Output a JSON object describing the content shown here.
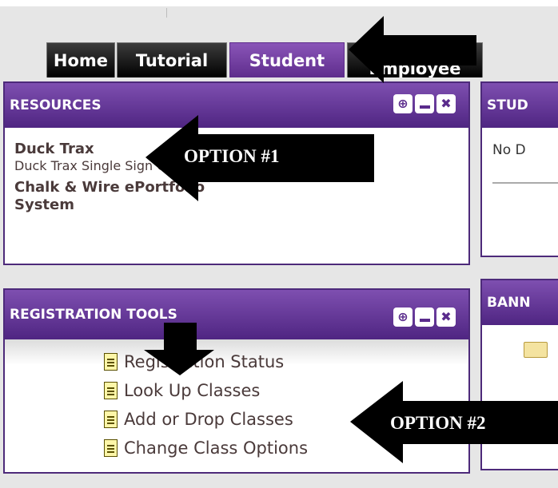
{
  "tabs": [
    {
      "label": "Home",
      "active": false
    },
    {
      "label": "Tutorial",
      "active": false
    },
    {
      "label": "Student",
      "active": true
    },
    {
      "label": "Employee",
      "active": false
    }
  ],
  "resources": {
    "title": "RESOURCES",
    "items": [
      {
        "label": "Duck Trax",
        "sub": "Duck Trax Single Sign On"
      },
      {
        "label": "Chalk & Wire ePortfolio System"
      }
    ]
  },
  "registration_tools": {
    "title": "REGISTRATION TOOLS",
    "items": [
      "Registration Status",
      "Look Up Classes",
      "Add or Drop Classes",
      "Change Class Options"
    ]
  },
  "student_portlet": {
    "title": "STUD",
    "body": "No D"
  },
  "banner_portlet": {
    "title": "BANN"
  },
  "annotations": {
    "option1": "OPTION #1",
    "option2": "OPTION #2"
  },
  "colors": {
    "header_purple": "#5e2d8c",
    "tab_black": "#000000",
    "arrow": "#000000"
  }
}
